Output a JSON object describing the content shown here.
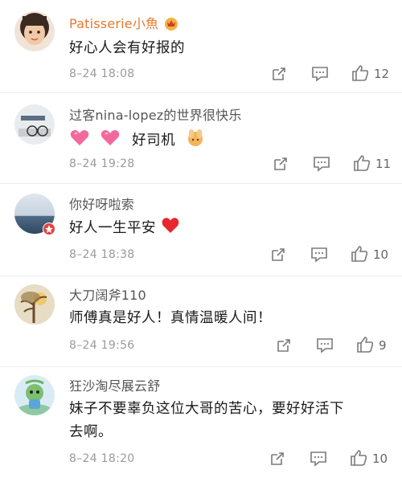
{
  "comments": [
    {
      "username": "Patisserie小魚",
      "text": "好心人会有好报的",
      "timestamp": "8–24 18:08",
      "likes": "12",
      "avatar": "avatar-photo-child"
    },
    {
      "username": "过客nina-lopez的世界很快乐",
      "text_prefix_icons": [
        "heart-icon",
        "heart-icon"
      ],
      "text": "好司机",
      "text_suffix_icon": "hands-icon",
      "timestamp": "8–24 19:28",
      "likes": "11",
      "avatar": "avatar-photo-desk"
    },
    {
      "username": "你好呀啦索",
      "text": "好人一生平安",
      "text_suffix_icon": "red-heart-icon",
      "timestamp": "8–24 18:38",
      "likes": "10",
      "avatar": "avatar-photo-sea"
    },
    {
      "username": "大刀阔斧110",
      "text": "师傅真是好人！真情温暖人间！",
      "timestamp": "8–24 19:56",
      "likes": "9",
      "avatar": "avatar-photo-tree"
    },
    {
      "username": "狂沙淘尽展云舒",
      "text_line1": "妹子不要辜负这位大哥的苦心，要好好活下",
      "text_line2": "去啊。",
      "timestamp": "8–24 18:20",
      "likes": "10",
      "avatar": "avatar-illustration-character"
    }
  ],
  "colors": {
    "vip_name": "#e8772e",
    "normal_name": "#555555",
    "meta": "#9a9a9a",
    "icon": "#7a7a7a",
    "badge": "#e2423f"
  }
}
